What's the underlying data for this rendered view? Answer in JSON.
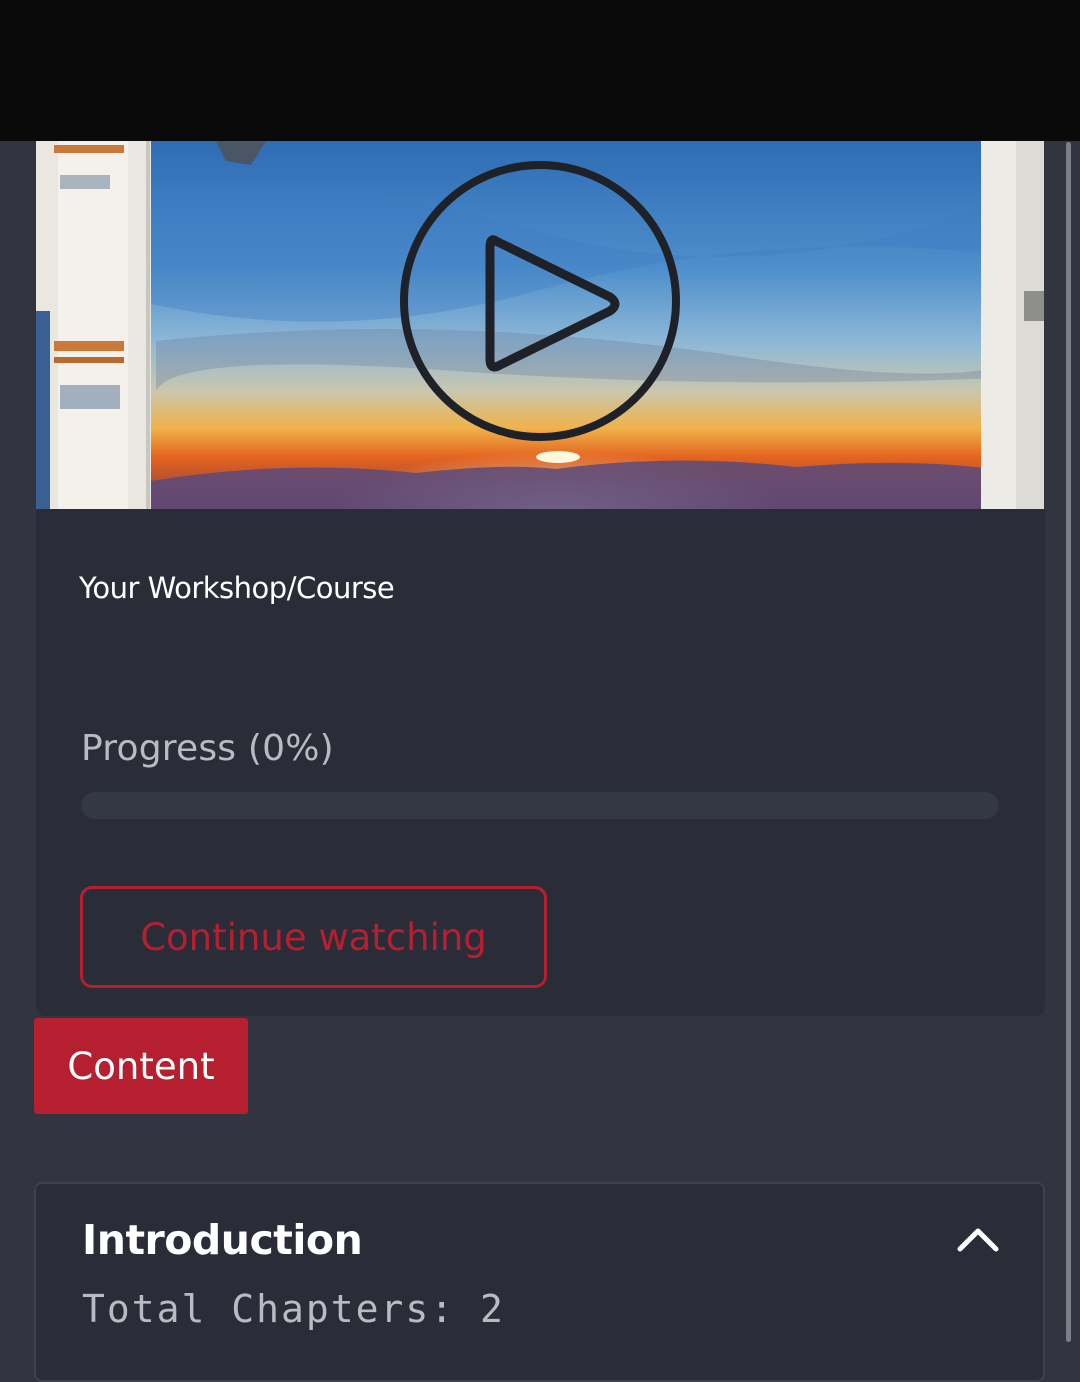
{
  "video": {
    "play_icon": "play-circle-icon"
  },
  "course": {
    "title": "Your Workshop/Course",
    "progress_label": "Progress (0%)",
    "progress_percent": 0,
    "continue_label": "Continue watching"
  },
  "tabs": {
    "content_label": "Content"
  },
  "chapter": {
    "title": "Introduction",
    "count_label": "Total Chapters: 2",
    "toggle_icon": "chevron-up-icon"
  },
  "colors": {
    "accent": "#b51f2f",
    "page_background": "#32343f",
    "card_background": "#2a2c38",
    "status_bar": "#0a0a0b"
  }
}
